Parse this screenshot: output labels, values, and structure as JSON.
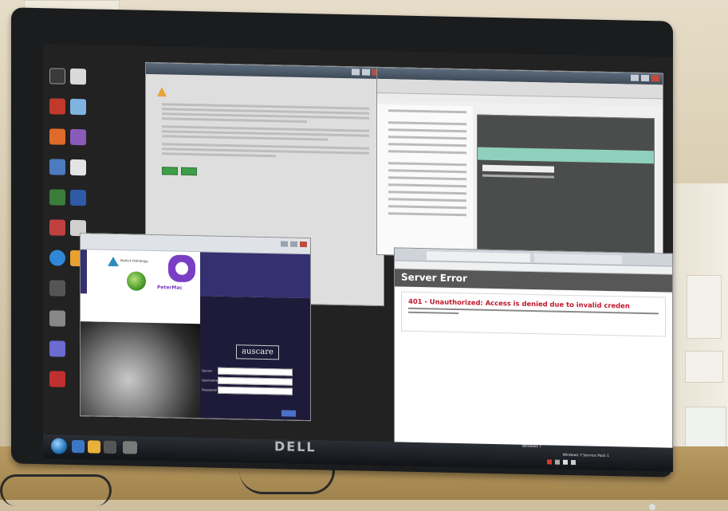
{
  "windows": {
    "login": {
      "brand_left": "Mellick Pathology",
      "brand_right": "PeterMac",
      "app_logo": "auscare",
      "fields": [
        {
          "label": "Server",
          "value": ""
        },
        {
          "label": "Username",
          "value": ""
        },
        {
          "label": "Password",
          "value": ""
        }
      ]
    },
    "server_error": {
      "header": "Server Error",
      "error_title": "401 - Unauthorized: Access is denied due to invalid creden"
    }
  },
  "taskbar": {
    "build_lines": [
      "Windows 7",
      "Windows 7 Service Pack 1"
    ]
  },
  "monitor": {
    "brand": "DELL"
  },
  "colors": {
    "error_red": "#c0172b",
    "login_purple": "#35306f",
    "teal_highlight": "#8fd0bd",
    "taskbar": "#1b1e23"
  }
}
